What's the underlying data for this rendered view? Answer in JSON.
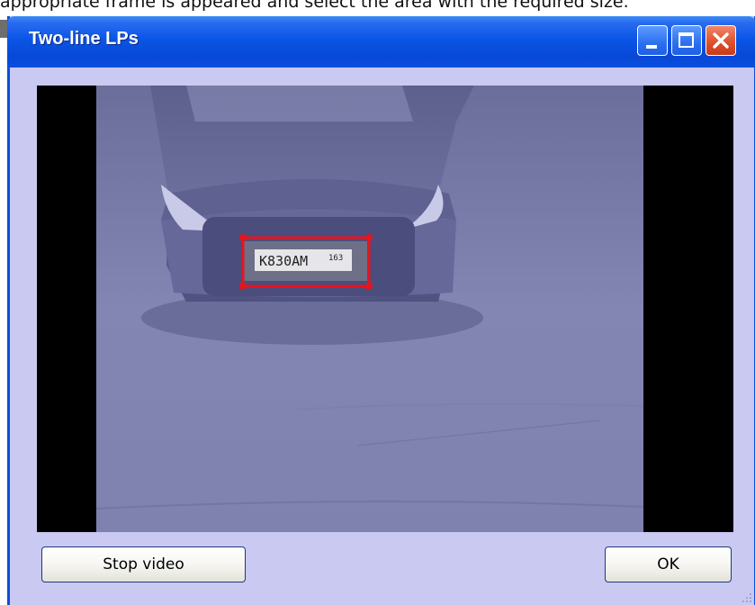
{
  "document": {
    "caption_text": "appropriate frame is appeared and select the area with the required size."
  },
  "window": {
    "title": "Two-line LPs",
    "titlebar_color": "#0a55e5",
    "body_color": "#c9c9f2",
    "controls": {
      "minimize": "minimize-icon",
      "maximize": "maximize-icon",
      "close": "close-icon"
    }
  },
  "video": {
    "plate_text": "K830AM",
    "plate_region": "163",
    "selection_color": "#e8141c"
  },
  "buttons": {
    "stop_label": "Stop video",
    "ok_label": "OK"
  }
}
